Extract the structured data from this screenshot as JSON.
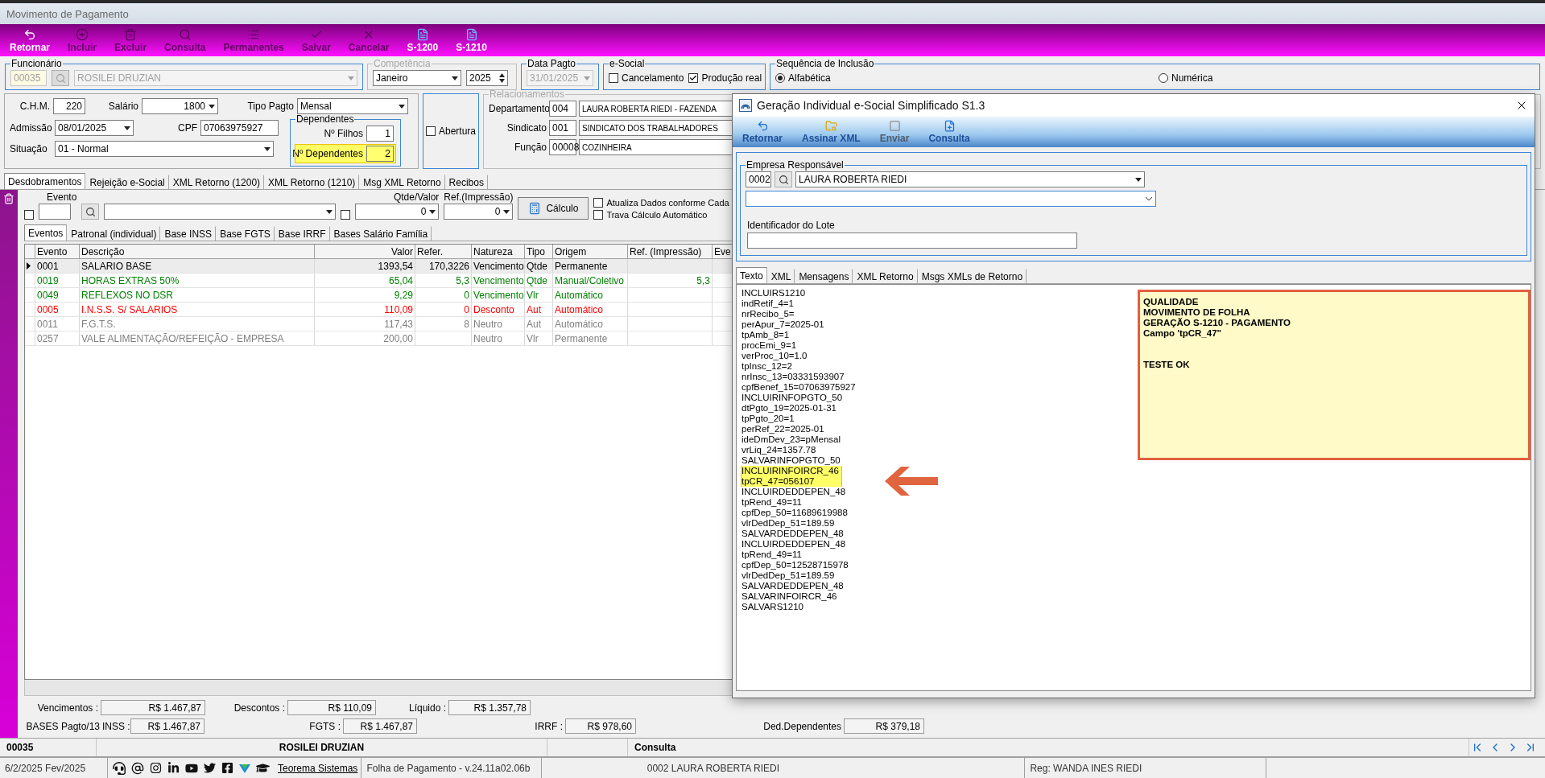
{
  "window": {
    "title": "Movimento de Pagamento"
  },
  "toolbar": [
    {
      "label": "Retornar",
      "disabled": false
    },
    {
      "label": "Incluir",
      "disabled": true
    },
    {
      "label": "Excluir",
      "disabled": true
    },
    {
      "label": "Consulta",
      "disabled": true
    },
    {
      "label": "Permanentes",
      "disabled": true
    },
    {
      "label": "Salvar",
      "disabled": true
    },
    {
      "label": "Cancelar",
      "disabled": true
    },
    {
      "label": "S-1200",
      "disabled": false
    },
    {
      "label": "S-1210",
      "disabled": false
    }
  ],
  "funcionario": {
    "legend": "Funcionário",
    "code": "00035",
    "name": "ROSILEI DRUZIAN",
    "disabled": true
  },
  "competencia": {
    "legend": "Competência",
    "month": "Janeiro",
    "year": "2025",
    "disabled": true
  },
  "data_pagto": {
    "legend": "Data Pagto",
    "value": "31/01/2025",
    "disabled": true
  },
  "esocial": {
    "legend": "e-Social",
    "options": [
      {
        "label": "Cancelamento",
        "checked": false
      },
      {
        "label": "Produção real",
        "checked": true
      }
    ]
  },
  "sequencia": {
    "legend": "Sequência de Inclusão",
    "options": [
      {
        "label": "Alfabética",
        "selected": true
      },
      {
        "label": "Numérica",
        "selected": false
      }
    ]
  },
  "dados": {
    "chm_label": "C.H.M.",
    "chm": "220",
    "salario_label": "Salário",
    "salario": "1800",
    "tipo_pagto_label": "Tipo Pagto",
    "tipo_pagto": "Mensal",
    "admissao_label": "Admissão",
    "admissao": "08/01/2025",
    "cpf_label": "CPF",
    "cpf": "07063975927",
    "situacao_label": "Situação",
    "situacao": "01 - Normal"
  },
  "dependentes": {
    "legend": "Dependentes",
    "filhos_label": "Nº Filhos",
    "filhos": "1",
    "dependentes_label": "Nº Dependentes",
    "dependentes": "2",
    "highlighted": true
  },
  "abertura": {
    "label": "Abertura",
    "checked": false
  },
  "relacionamentos": {
    "legend": "Relacionamentos",
    "disabled": true,
    "rows": [
      {
        "label": "Departamento",
        "code": "004",
        "name": "LAURA ROBERTA RIEDI - FAZENDA"
      },
      {
        "label": "Sindicato",
        "code": "001",
        "name": "SINDICATO DOS TRABALHADORES"
      },
      {
        "label": "Função",
        "code": "00008",
        "name": "COZINHEIRA"
      }
    ]
  },
  "tabs": [
    {
      "label": "Desdobramentos",
      "selected": true
    },
    {
      "label": "Rejeição e-Social",
      "selected": false
    },
    {
      "label": "XML Retorno (1200)",
      "selected": false
    },
    {
      "label": "XML Retorno (1210)",
      "selected": false
    },
    {
      "label": "Msg XML Retorno",
      "selected": false
    },
    {
      "label": "Recibos",
      "selected": false
    }
  ],
  "evento_filter": {
    "evento_label": "Evento",
    "evento_checked": false,
    "qtde_label": "Qtde/Valor",
    "qtde_checked": false,
    "qtde": "0",
    "ref_label": "Ref.(Impressão)",
    "ref": "0",
    "calc_button": "Cálculo",
    "options": [
      {
        "label": "Atualiza Dados conforme Cada",
        "checked": false
      },
      {
        "label": "Trava Cálculo Automático",
        "checked": false
      }
    ]
  },
  "subtabs": [
    {
      "label": "Eventos",
      "selected": true
    },
    {
      "label": "Patronal (individual)",
      "selected": false
    },
    {
      "label": "Base INSS",
      "selected": false
    },
    {
      "label": "Base FGTS",
      "selected": false
    },
    {
      "label": "Base IRRF",
      "selected": false
    },
    {
      "label": "Bases Salário Família",
      "selected": false
    }
  ],
  "table": {
    "columns": [
      "Evento",
      "Descrição",
      "Valor",
      "Refer.",
      "Natureza",
      "Tipo",
      "Origem",
      "Ref. (Impressão)",
      "Eve"
    ],
    "rows": [
      {
        "evento": "0001",
        "descricao": "SALARIO BASE",
        "valor": "1393,54",
        "refer": "170,3226",
        "natureza": "Vencimento",
        "tipo": "Qtde",
        "origem": "Permanente",
        "color": "#000000",
        "selected": true
      },
      {
        "evento": "0019",
        "descricao": "HORAS EXTRAS 50%",
        "valor": "65,04",
        "refer": "5,3",
        "natureza": "Vencimento",
        "tipo": "Qtde",
        "origem": "Manual/Coletivo",
        "ref_impressao": "5,3",
        "color": "#008000",
        "selected": false
      },
      {
        "evento": "0049",
        "descricao": "REFLEXOS NO DSR",
        "valor": "9,29",
        "refer": "0",
        "natureza": "Vencimento",
        "tipo": "Vlr",
        "origem": "Automático",
        "color": "#008000",
        "selected": false
      },
      {
        "evento": "0005",
        "descricao": "I.N.S.S. S/ SALARIOS",
        "valor": "110,09",
        "refer": "0",
        "natureza": "Desconto",
        "tipo": "Aut",
        "origem": "Automático",
        "color": "#ff0000",
        "selected": false
      },
      {
        "evento": "0011",
        "descricao": "F.G.T.S.",
        "valor": "117,43",
        "refer": "8",
        "natureza": "Neutro",
        "tipo": "Aut",
        "origem": "Automático",
        "color": "#808080",
        "selected": false
      },
      {
        "evento": "0257",
        "descricao": "VALE ALIMENTAÇÃO/REFEIÇÃO - EMPRESA",
        "valor": "200,00",
        "natureza": "Neutro",
        "tipo": "Vlr",
        "origem": "Permanente",
        "color": "#808080",
        "selected": false
      }
    ]
  },
  "totals": {
    "vencimentos_label": "Vencimentos :",
    "vencimentos": "R$ 1.467,87",
    "descontos_label": "Descontos  :",
    "descontos": "R$ 110,09",
    "liquido_label": "Líquido :",
    "liquido": "R$ 1.357,78",
    "bases_label": "BASES Pagto/13",
    "inss_label": "INSS :",
    "inss": "R$ 1.467,87",
    "fgts_label": "FGTS :",
    "fgts": "R$ 1.467,87",
    "irrf_label": "IRRF :",
    "irrf": "R$ 978,60",
    "ded_label": "Ded.Dependentes",
    "ded": "R$ 379,18"
  },
  "record_bar": {
    "code": "00035",
    "name": "ROSILEI DRUZIAN",
    "mode": "Consulta"
  },
  "status_bar": {
    "date": "6/2/2025 Fev/2025",
    "link": "Teorema Sistemas",
    "version": "Folha de Pagamento - v.24.11a02.06b",
    "company": "0002 LAURA ROBERTA RIEDI",
    "user": "Reg: WANDA INES RIEDI"
  },
  "dialog": {
    "title": "Geração Individual e-Social Simplificado S1.3",
    "toolbar": [
      {
        "label": "Retornar",
        "disabled": false
      },
      {
        "label": "Assinar XML",
        "disabled": false
      },
      {
        "label": "Enviar",
        "disabled": true
      },
      {
        "label": "Consulta",
        "disabled": false
      }
    ],
    "empresa": {
      "legend": "Empresa Responsável",
      "code": "0002",
      "name": "LAURA ROBERTA RIEDI"
    },
    "lote_label": "Identificador do Lote",
    "tabs": [
      {
        "label": "Texto",
        "selected": true
      },
      {
        "label": "XML",
        "selected": false
      },
      {
        "label": "Mensagens",
        "selected": false
      },
      {
        "label": "XML Retorno",
        "selected": false
      },
      {
        "label": "Msgs XMLs de Retorno",
        "selected": false
      }
    ],
    "lines": [
      {
        "text": "INCLUIRS1210",
        "highlighted": false
      },
      {
        "text": "indRetif_4=1",
        "highlighted": false
      },
      {
        "text": "nrRecibo_5=",
        "highlighted": false
      },
      {
        "text": "perApur_7=2025-01",
        "highlighted": false
      },
      {
        "text": "tpAmb_8=1",
        "highlighted": false
      },
      {
        "text": "procEmi_9=1",
        "highlighted": false
      },
      {
        "text": "verProc_10=1.0",
        "highlighted": false
      },
      {
        "text": "tpInsc_12=2",
        "highlighted": false
      },
      {
        "text": "nrInsc_13=03331593907",
        "highlighted": false
      },
      {
        "text": "cpfBenef_15=07063975927",
        "highlighted": false
      },
      {
        "text": "INCLUIRINFOPGTO_50",
        "highlighted": false
      },
      {
        "text": "dtPgto_19=2025-01-31",
        "highlighted": false
      },
      {
        "text": "tpPgto_20=1",
        "highlighted": false
      },
      {
        "text": "perRef_22=2025-01",
        "highlighted": false
      },
      {
        "text": "ideDmDev_23=pMensal",
        "highlighted": false
      },
      {
        "text": "vrLiq_24=1357.78",
        "highlighted": false
      },
      {
        "text": "SALVARINFOPGTO_50",
        "highlighted": false
      },
      {
        "text": "INCLUIRINFOIRCR_46",
        "highlighted": true
      },
      {
        "text": "tpCR_47=056107",
        "highlighted": true
      },
      {
        "text": "INCLUIRDEDDEPEN_48",
        "highlighted": false
      },
      {
        "text": "tpRend_49=11",
        "highlighted": false
      },
      {
        "text": "cpfDep_50=11689619988",
        "highlighted": false
      },
      {
        "text": "vlrDedDep_51=189.59",
        "highlighted": false
      },
      {
        "text": "SALVARDEDDEPEN_48",
        "highlighted": false
      },
      {
        "text": "INCLUIRDEDDEPEN_48",
        "highlighted": false
      },
      {
        "text": "tpRend_49=11",
        "highlighted": false
      },
      {
        "text": "cpfDep_50=12528715978",
        "highlighted": false
      },
      {
        "text": "vlrDedDep_51=189.59",
        "highlighted": false
      },
      {
        "text": "SALVARDEDDEPEN_48",
        "highlighted": false
      },
      {
        "text": "SALVARINFOIRCR_46",
        "highlighted": false
      },
      {
        "text": "SALVARS1210",
        "highlighted": false
      }
    ],
    "note": {
      "paragraphs": [
        [
          "QUALIDADE",
          "MOVIMENTO DE FOLHA",
          "GERAÇÃO S-1210 - PAGAMENTO",
          "Campo 'tpCR_47\""
        ],
        [
          "TESTE OK"
        ]
      ]
    }
  }
}
